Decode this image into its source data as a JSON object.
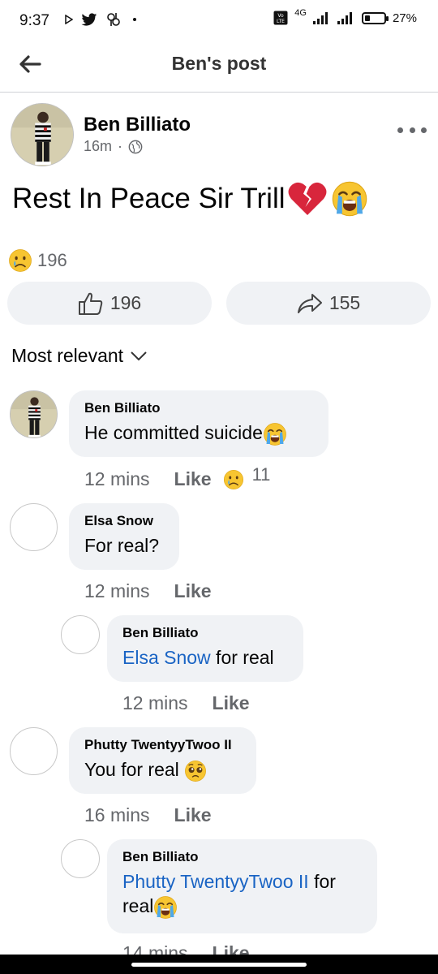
{
  "status_bar": {
    "time": "9:37",
    "network": "4G",
    "battery": "27%",
    "battery_level": 0.27
  },
  "header": {
    "title": "Ben's post"
  },
  "post": {
    "author": "Ben Billiato",
    "time": "16m",
    "separator": "·",
    "text": "Rest In Peace Sir Trill",
    "reaction_count": "196",
    "likes": "196",
    "shares": "155"
  },
  "sort": {
    "label": "Most relevant"
  },
  "comments": [
    {
      "name": "Ben Billiato",
      "text": "He committed suicide",
      "time": "12 mins",
      "like_label": "Like",
      "reaction_count": "11"
    },
    {
      "name": "Elsa Snow",
      "text": "For real?",
      "time": "12 mins",
      "like_label": "Like",
      "replies": [
        {
          "name": "Ben Billiato",
          "mention": "Elsa Snow",
          "text": " for real",
          "time": "12 mins",
          "like_label": "Like"
        }
      ]
    },
    {
      "name": "Phutty TwentyyTwoo II",
      "text": "You for real",
      "time": "16 mins",
      "like_label": "Like",
      "replies": [
        {
          "name": "Ben Billiato",
          "mention": "Phutty TwentyyTwoo II",
          "text_line1": " for",
          "text_line2": "real",
          "time": "14 mins",
          "like_label": "Like"
        }
      ]
    }
  ],
  "colors": {
    "mention": "#1a64c4",
    "bubble": "#f0f2f5",
    "secondary_text": "#65676b"
  },
  "icons": [
    "back-arrow-icon",
    "globe-icon",
    "more-icon",
    "thumbs-up-icon",
    "share-arrow-icon",
    "chevron-down-icon",
    "sad-emoji-icon",
    "crying-emoji-icon",
    "broken-heart-icon",
    "pleading-emoji-icon"
  ]
}
